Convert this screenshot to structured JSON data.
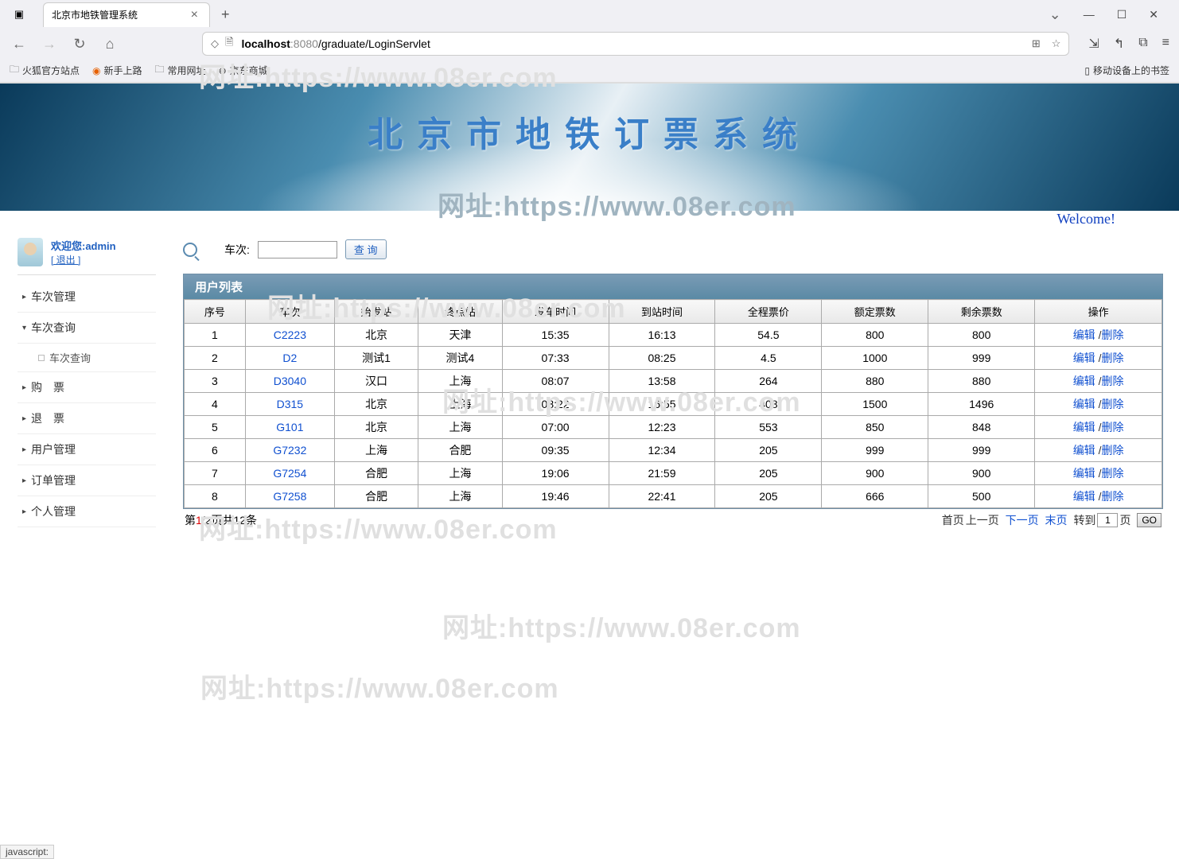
{
  "browser": {
    "tab_title": "北京市地铁管理系统",
    "url_host": "localhost",
    "url_port": ":8080",
    "url_path": "/graduate/LoginServlet",
    "bookmarks": [
      "火狐官方站点",
      "新手上路",
      "常用网址",
      "京东商城"
    ],
    "mobile_bookmarks": "移动设备上的书签"
  },
  "banner_title": "北京市地铁订票系统",
  "welcome": "Welcome!",
  "user": {
    "greeting": "欢迎您:admin",
    "logout": "[ 退出 ]"
  },
  "menu": {
    "items": [
      "车次管理",
      "车次查询",
      "购　票",
      "退　票",
      "用户管理",
      "订单管理",
      "个人管理"
    ],
    "sub": "车次查询"
  },
  "search": {
    "label": "车次:",
    "button": "查 询"
  },
  "table": {
    "title": "用户列表",
    "headers": [
      "序号",
      "车次",
      "始发站",
      "终点站",
      "发车时间",
      "到站时间",
      "全程票价",
      "额定票数",
      "剩余票数",
      "操作"
    ],
    "rows": [
      {
        "no": "1",
        "train": "C2223",
        "from": "北京",
        "to": "天津",
        "dep": "15:35",
        "arr": "16:13",
        "price": "54.5",
        "cap": "800",
        "remain": "800"
      },
      {
        "no": "2",
        "train": "D2",
        "from": "测试1",
        "to": "测试4",
        "dep": "07:33",
        "arr": "08:25",
        "price": "4.5",
        "cap": "1000",
        "remain": "999"
      },
      {
        "no": "3",
        "train": "D3040",
        "from": "汉口",
        "to": "上海",
        "dep": "08:07",
        "arr": "13:58",
        "price": "264",
        "cap": "880",
        "remain": "880"
      },
      {
        "no": "4",
        "train": "D315",
        "from": "北京",
        "to": "上海",
        "dep": "08:22",
        "arr": "16:55",
        "price": "408",
        "cap": "1500",
        "remain": "1496"
      },
      {
        "no": "5",
        "train": "G101",
        "from": "北京",
        "to": "上海",
        "dep": "07:00",
        "arr": "12:23",
        "price": "553",
        "cap": "850",
        "remain": "848"
      },
      {
        "no": "6",
        "train": "G7232",
        "from": "上海",
        "to": "合肥",
        "dep": "09:35",
        "arr": "12:34",
        "price": "205",
        "cap": "999",
        "remain": "999"
      },
      {
        "no": "7",
        "train": "G7254",
        "from": "合肥",
        "to": "上海",
        "dep": "19:06",
        "arr": "21:59",
        "price": "205",
        "cap": "900",
        "remain": "900"
      },
      {
        "no": "8",
        "train": "G7258",
        "from": "合肥",
        "to": "上海",
        "dep": "19:46",
        "arr": "22:41",
        "price": "205",
        "cap": "666",
        "remain": "500"
      }
    ],
    "ops": {
      "edit": "编辑",
      "delete": "删除"
    }
  },
  "pager": {
    "prefix": "第",
    "current": "1",
    "mid": "/2页共12条",
    "first": "首页",
    "prev": "上一页",
    "next": "下一页",
    "last": "末页",
    "goto": "转到",
    "page_val": "1",
    "page_suffix": "页",
    "go": "GO"
  },
  "status": "javascript:",
  "watermark": "网址:https://www.08er.com"
}
